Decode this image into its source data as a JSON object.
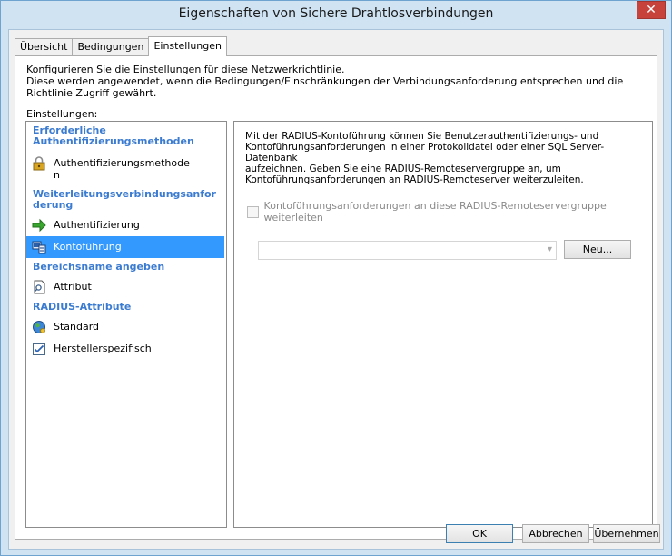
{
  "window": {
    "title": "Eigenschaften von Sichere Drahtlosverbindungen",
    "close_symbol": "✕"
  },
  "tabs": [
    {
      "label": "Übersicht",
      "active": false
    },
    {
      "label": "Bedingungen",
      "active": false
    },
    {
      "label": "Einstellungen",
      "active": true
    }
  ],
  "description": {
    "line1": "Konfigurieren Sie die Einstellungen für diese Netzwerkrichtlinie.",
    "line2": "Diese werden angewendet, wenn die Bedingungen/Einschränkungen der Verbindungsanforderung entsprechen und die Richtlinie Zugriff gewährt."
  },
  "settings_label": "Einstellungen:",
  "nav": {
    "categories": [
      {
        "label_line1": "Erforderliche",
        "label_line2": "Authentifizierungsmethoden"
      },
      {
        "label_line1": "Weiterleitungsverbindungsanfor",
        "label_line2": "derung"
      },
      {
        "label_line1": "Bereichsname angeben"
      },
      {
        "label_line1": "RADIUS-Attribute"
      }
    ],
    "items": [
      {
        "label_line1": "Authentifizierungsmethode",
        "label_line2": "n",
        "icon": "lock-icon",
        "selected": false
      },
      {
        "label_line1": "Authentifizierung",
        "icon": "green-arrow-icon",
        "selected": false
      },
      {
        "label_line1": "Kontoführung",
        "icon": "accounting-icon",
        "selected": true
      },
      {
        "label_line1": "Attribut",
        "icon": "document-search-icon",
        "selected": false
      },
      {
        "label_line1": "Standard",
        "icon": "globe-icon",
        "selected": false
      },
      {
        "label_line1": "Herstellerspezifisch",
        "icon": "checklist-icon",
        "selected": false
      }
    ]
  },
  "content": {
    "info_lines": [
      "Mit der RADIUS-Kontoführung können Sie Benutzerauthentifizierungs- und",
      "Kontoführungsanforderungen in einer Protokolldatei oder einer SQL Server-Datenbank",
      "aufzeichnen. Geben Sie eine RADIUS-Remoteservergruppe an, um",
      "Kontoführungsanforderungen an RADIUS-Remoteserver weiterzuleiten."
    ],
    "checkbox_label": "Kontoführungsanforderungen an diese RADIUS-Remoteservergruppe weiterleiten",
    "checkbox_checked": false,
    "combo_value": "",
    "new_button": "Neu..."
  },
  "footer": {
    "ok": "OK",
    "cancel": "Abbrechen",
    "apply": "Übernehmen"
  },
  "colors": {
    "accent": "#3399ff",
    "category": "#3b7bd0",
    "title_bar": "#cfe3f3",
    "close": "#c7423b"
  }
}
